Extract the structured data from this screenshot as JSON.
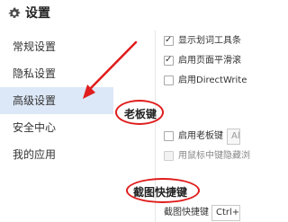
{
  "header": {
    "title": "设置",
    "icon": "gear-icon"
  },
  "sidebar": {
    "items": [
      {
        "label": "常规设置",
        "active": false
      },
      {
        "label": "隐私设置",
        "active": false
      },
      {
        "label": "高级设置",
        "active": true
      },
      {
        "label": "安全中心",
        "active": false
      },
      {
        "label": "我的应用",
        "active": false
      }
    ]
  },
  "options": [
    {
      "label": "显示划词工具条",
      "checked": true
    },
    {
      "label": "启用页面平滑滚",
      "checked": true
    },
    {
      "label": "启用DirectWrite",
      "checked": false
    }
  ],
  "boss_key": {
    "title": "老板键",
    "enable_label": "启用老板键",
    "shortcut_value": "Al",
    "middle_click_label": "用鼠标中键隐藏浏"
  },
  "screenshot_key": {
    "title": "截图快捷键",
    "field_label": "截图快捷键",
    "shortcut_value": "Ctrl+S"
  },
  "colors": {
    "highlight": "#e01c1c",
    "active_nav": "#dce8f7"
  }
}
